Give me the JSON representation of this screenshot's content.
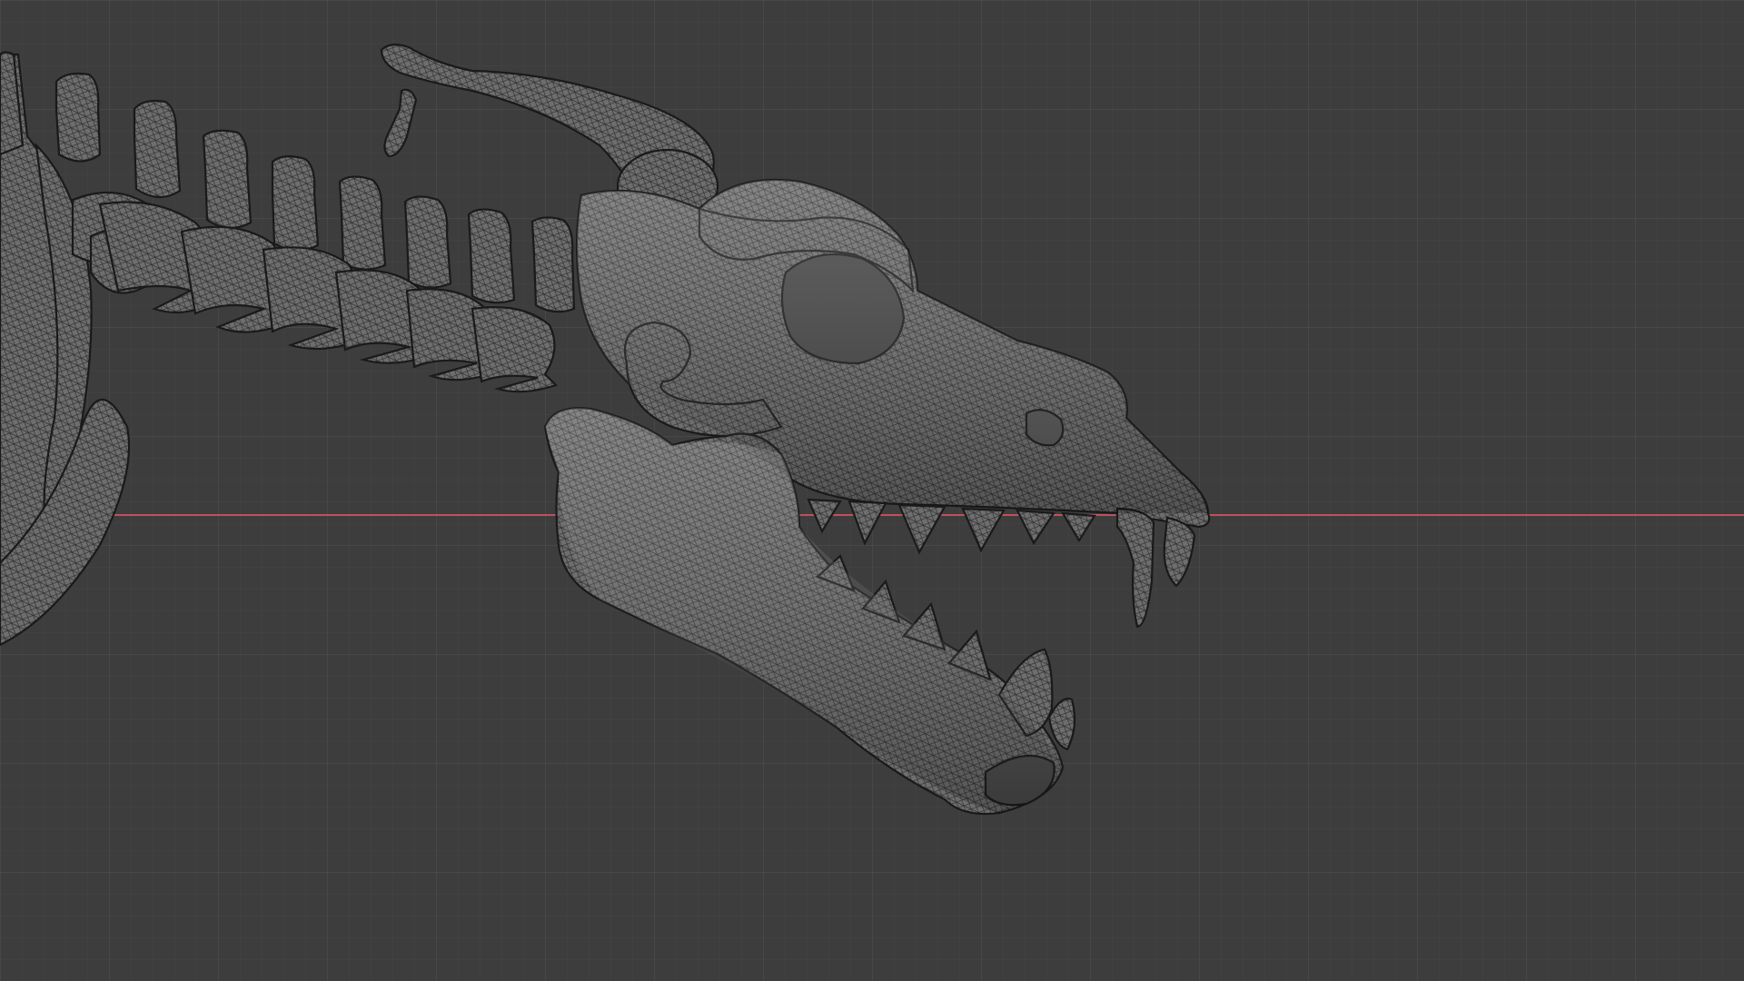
{
  "viewport": {
    "background_color": "#3d3d3d",
    "grid_minor_color": "#454545",
    "grid_major_color": "#4b4b4b",
    "x_axis_color": "#c0505e",
    "mesh_fill_color": "#6e6e6e",
    "mesh_wire_color": "#1c1c1c",
    "mesh_highlight_color": "#9a9a9a"
  },
  "scene": {
    "object": "skeleton-skull-and-spine",
    "shading": "wireframe-overlay",
    "visible_parts": [
      "neck-vertebrae",
      "skull",
      "horn",
      "lower-jaw",
      "upper-teeth",
      "lower-teeth",
      "ribcage"
    ]
  }
}
